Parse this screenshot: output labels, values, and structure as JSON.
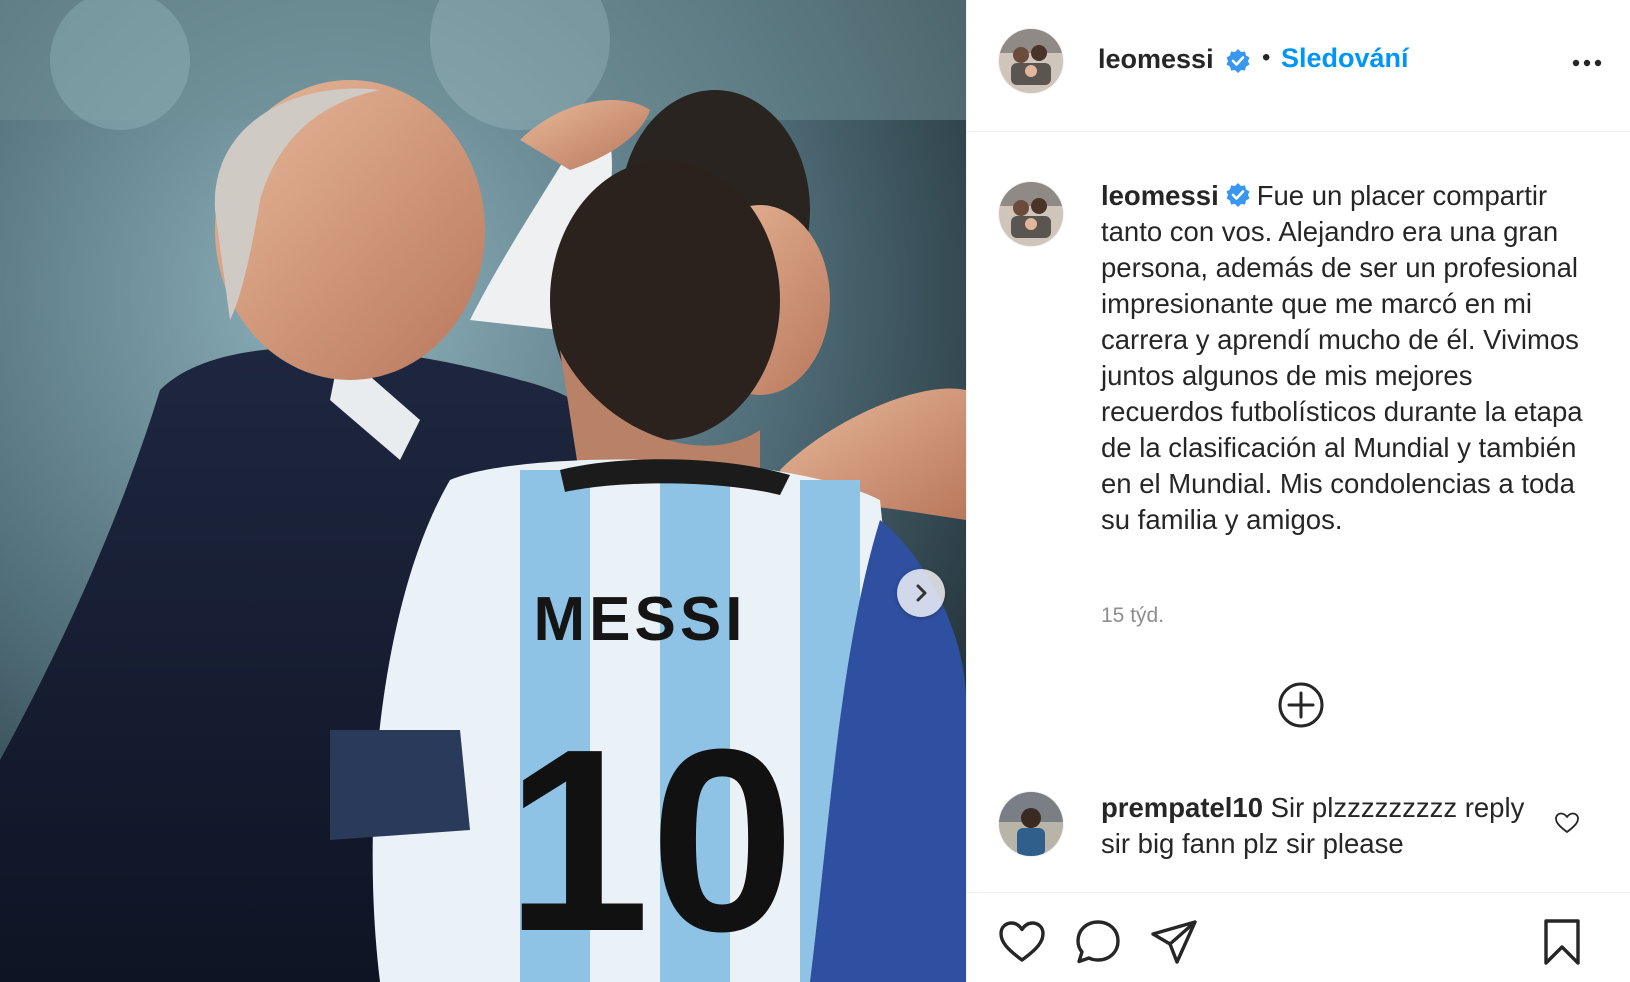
{
  "post": {
    "username": "leomessi",
    "follow_state": "Sledování",
    "separator": "•",
    "caption": "Fue un placer compartir tanto con vos. Alejandro era una gran persona, además de ser un profesional impresionante que me marcó en mi carrera y aprendí mucho de él. Vivimos juntos algunos de mis mejores recuerdos futbolísticos durante la etapa de la clasificación al Mundial y también en el Mundial. Mis condolencias a toda su familia y amigos.",
    "time_ago": "15 týd.",
    "photo": {
      "jersey_name": "MESSI",
      "jersey_number": "10"
    }
  },
  "comments": [
    {
      "username": "prempatel10",
      "text": "Sir plzzzzzzzzz reply sir big fann plz sir please"
    }
  ],
  "icons": {
    "verified": "verified-badge-icon",
    "more": "more-options-icon",
    "load_more": "plus-circle-icon",
    "like": "heart-icon",
    "comment": "comment-bubble-icon",
    "share": "paper-plane-icon",
    "save": "bookmark-icon",
    "next": "chevron-right-icon"
  },
  "colors": {
    "link_blue": "#0095f6",
    "verified_blue": "#3897f0",
    "text": "#262626",
    "muted": "#8e8e8e",
    "divider": "#efefef"
  }
}
